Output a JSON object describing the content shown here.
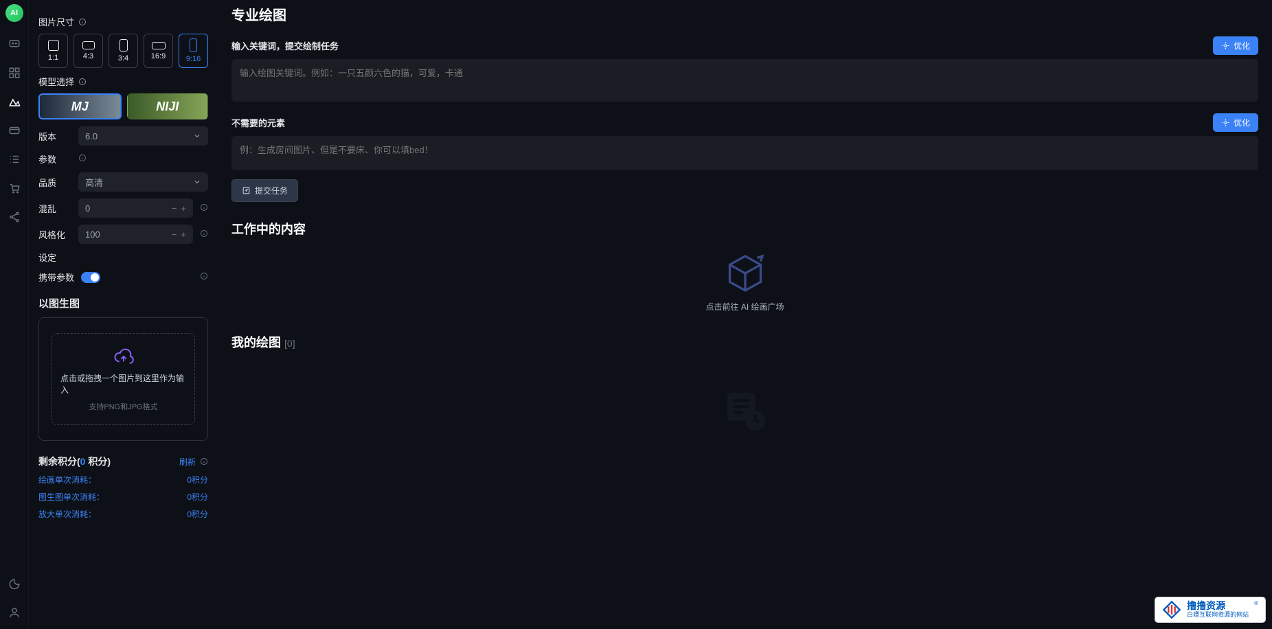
{
  "iconbar": {
    "logo": "AI"
  },
  "sidebar": {
    "image_size_label": "图片尺寸",
    "ratios": [
      {
        "label": "1:1",
        "w": 16,
        "h": 16
      },
      {
        "label": "4:3",
        "w": 18,
        "h": 12
      },
      {
        "label": "3:4",
        "w": 12,
        "h": 18
      },
      {
        "label": "16:9",
        "w": 20,
        "h": 11
      },
      {
        "label": "9:16",
        "w": 11,
        "h": 20
      }
    ],
    "model_select_label": "模型选择",
    "models": {
      "mj": "MJ",
      "niji": "NIJI"
    },
    "version_label": "版本",
    "version_value": "6.0",
    "params_label": "参数",
    "quality_label": "品质",
    "quality_value": "高清",
    "chaos_label": "混乱",
    "chaos_value": "0",
    "stylize_label": "风格化",
    "stylize_value": "100",
    "settings_label": "设定",
    "carry_params_label": "携带参数",
    "img2img_label": "以图生图",
    "upload_text": "点击或拖拽一个图片到这里作为输入",
    "upload_sub": "支持PNG和JPG格式",
    "credits_label_pre": "剩余积分(",
    "credits_value": "0",
    "credits_unit": " 积分)",
    "refresh_label": "刷新",
    "cost_lines": [
      {
        "label": "绘画单次消耗：",
        "value": "0积分"
      },
      {
        "label": "图生图单次消耗：",
        "value": "0积分"
      },
      {
        "label": "放大单次消耗：",
        "value": "0积分"
      }
    ]
  },
  "main": {
    "title": "专业绘图",
    "prompt_label": "输入关键词，提交绘制任务",
    "optimize_btn": "优化",
    "prompt_placeholder": "输入绘图关键词。例如：一只五颜六色的猫，可爱，卡通",
    "negative_label": "不需要的元素",
    "negative_placeholder": "例：生成房间图片、但是不要床、你可以填bed！",
    "submit_btn": "提交任务",
    "working_title": "工作中的内容",
    "gallery_link": "点击前往 AI 绘画广场",
    "my_drawings_title": "我的绘图",
    "my_drawings_count": "[0]"
  },
  "watermark": {
    "main": "撸撸资源",
    "sub": "白嫖互联网资源的网站"
  }
}
